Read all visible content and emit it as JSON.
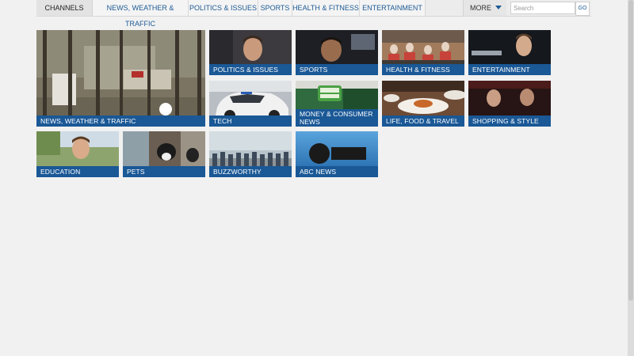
{
  "nav": {
    "channels_label": "CHANNELS",
    "items": [
      {
        "label": "NEWS, WEATHER & TRAFFIC"
      },
      {
        "label": "POLITICS & ISSUES"
      },
      {
        "label": "SPORTS"
      },
      {
        "label": "HEALTH & FITNESS"
      },
      {
        "label": "ENTERTAINMENT"
      }
    ],
    "more_label": "MORE",
    "search_placeholder": "Search",
    "go_label": "GO"
  },
  "tiles": [
    {
      "label": "NEWS, WEATHER & TRAFFIC"
    },
    {
      "label": "POLITICS & ISSUES"
    },
    {
      "label": "SPORTS"
    },
    {
      "label": "HEALTH & FITNESS"
    },
    {
      "label": "ENTERTAINMENT"
    },
    {
      "label": "TECH"
    },
    {
      "label": "MONEY & CONSUMER NEWS"
    },
    {
      "label": "LIFE, FOOD & TRAVEL"
    },
    {
      "label": "SHOPPING & STYLE"
    },
    {
      "label": "EDUCATION"
    },
    {
      "label": "PETS"
    },
    {
      "label": "BUZZWORTHY"
    },
    {
      "label": "ABC NEWS"
    }
  ],
  "colors": {
    "label_bar": "#1a5896",
    "nav_link": "#1d5a94"
  }
}
